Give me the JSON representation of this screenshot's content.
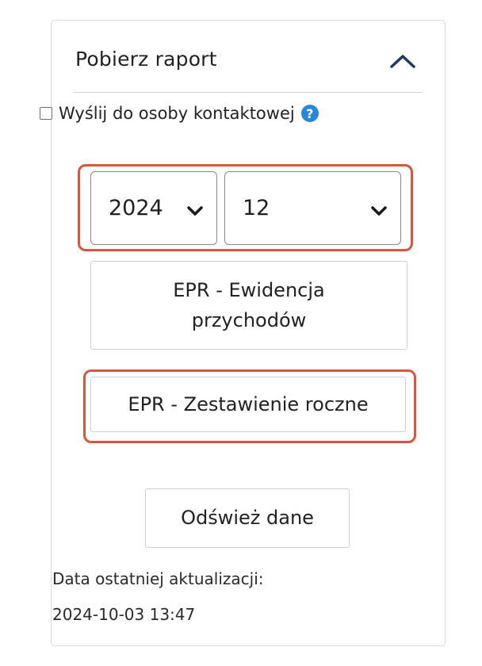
{
  "panel": {
    "title": "Pobierz raport",
    "collapse_icon": "chevron-up-icon"
  },
  "contact": {
    "checked": false,
    "label": "Wyślij do osoby kontaktowej",
    "help_glyph": "?"
  },
  "selectors": {
    "year": {
      "value": "2024",
      "icon": "chevron-down-icon"
    },
    "month": {
      "value": "12",
      "icon": "chevron-down-icon"
    }
  },
  "buttons": {
    "epr_ewidencja_line1": "EPR - Ewidencja",
    "epr_ewidencja_line2": "przychodów",
    "epr_zestawienie": "EPR - Zestawienie roczne",
    "refresh": "Odśwież dane"
  },
  "update": {
    "label": "Data ostatniej aktualizacji:",
    "timestamp": "2024-10-03 13:47"
  },
  "colors": {
    "highlight": "#d9553f",
    "help_icon": "#2a86d8",
    "chevron": "#1e3a5f"
  }
}
